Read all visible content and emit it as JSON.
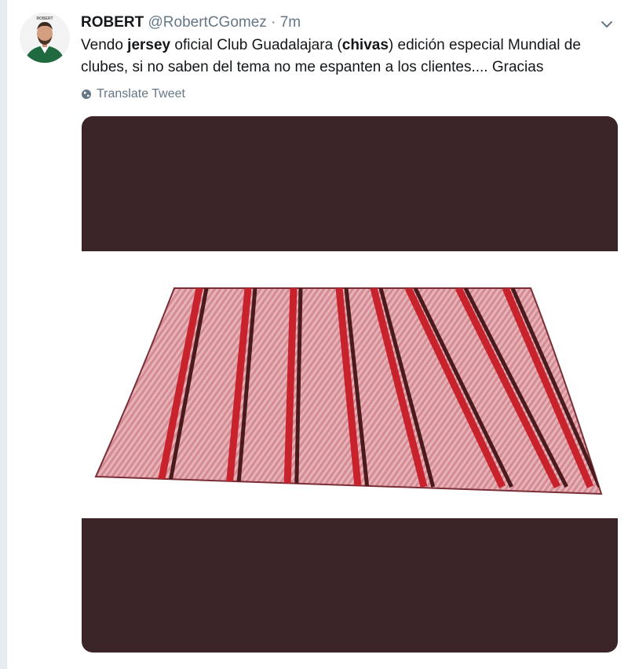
{
  "tweet": {
    "name": "ROBERT",
    "handle": "@RobertCGomez",
    "separator": "·",
    "time": "7m",
    "text_parts": [
      {
        "text": "Vendo ",
        "bold": false
      },
      {
        "text": "jersey",
        "bold": true
      },
      {
        "text": " oficial Club Guadalajara (",
        "bold": false
      },
      {
        "text": "chivas",
        "bold": true
      },
      {
        "text": ") edición especial Mundial de clubes, si no saben del tema no me espanten a los clientes.... Gracias",
        "bold": false
      }
    ],
    "translate_label": "Translate Tweet",
    "avatar_text": "ROBERT"
  },
  "icons": {
    "caret": "chevron-down-icon",
    "translate": "globe-icon"
  },
  "colors": {
    "media_bg": "#3c2528",
    "blanket_base": "#d58b93",
    "stripe_red": "#c8232d",
    "stripe_dark": "#4a1a1d",
    "muted_text": "#657786"
  }
}
